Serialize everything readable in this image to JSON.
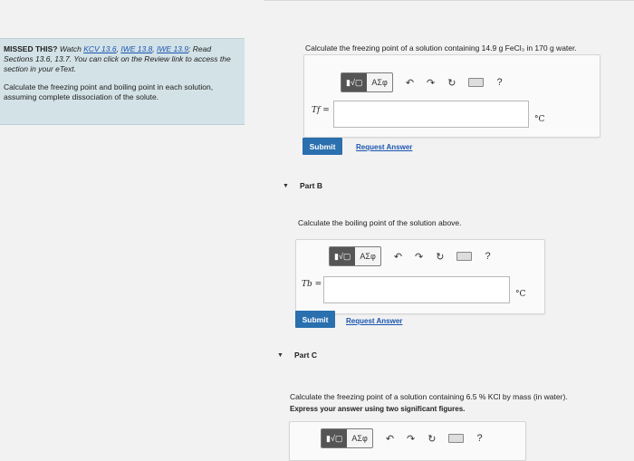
{
  "left_panel": {
    "missed_label": "MISSED THIS?",
    "watch_text": "Watch",
    "links": [
      "KCV 13.6",
      "IWE 13.8",
      "IWE 13.9"
    ],
    "read_text": "; Read Sections 13.6, 13.7. You can click on the Review link to access the section in your eText.",
    "instruction": "Calculate the freezing point and boiling point in each solution, assuming complete dissociation of the solute."
  },
  "part_a": {
    "question": "Calculate the freezing point of a solution containing 14.9 g FeCl₃ in 170 g water.",
    "var_label": "Tf =",
    "unit": "°C",
    "submit_label": "Submit",
    "request_label": "Request Answer"
  },
  "part_b": {
    "header": "Part B",
    "question": "Calculate the boiling point of the solution above.",
    "var_label": "Tb =",
    "unit": "°C",
    "submit_label": "Submit",
    "request_label": "Request Answer"
  },
  "part_c": {
    "header": "Part C",
    "question": "Calculate the freezing point of a solution containing 6.5 % KCl by mass (in water).",
    "instruction": "Express your answer using two significant figures."
  },
  "toolbar": {
    "templates_label": "▮√▢",
    "greek_label": "ΑΣφ",
    "undo_icon": "↶",
    "redo_icon": "↷",
    "reset_icon": "↻",
    "help_label": "?"
  }
}
